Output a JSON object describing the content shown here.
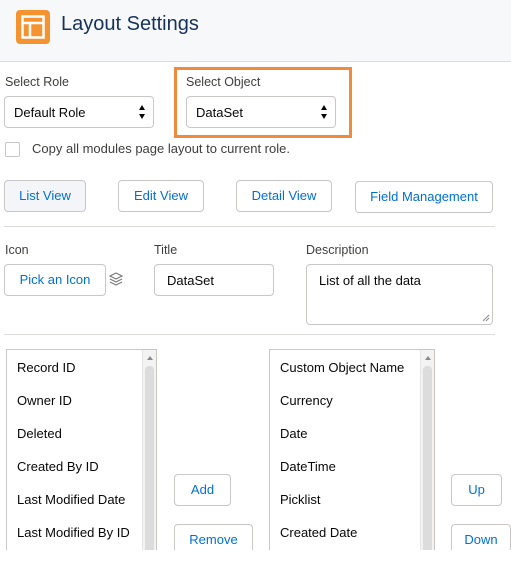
{
  "header": {
    "title": "Layout Settings",
    "icon": "layout-icon",
    "accent": "#f59331"
  },
  "role": {
    "label": "Select Role",
    "value": "Default Role"
  },
  "object": {
    "label": "Select Object",
    "value": "DataSet"
  },
  "copy_option": {
    "label": "Copy all modules page layout to current role.",
    "checked": false
  },
  "view_tabs": [
    {
      "label": "List View",
      "active": true
    },
    {
      "label": "Edit View",
      "active": false
    },
    {
      "label": "Detail View",
      "active": false
    },
    {
      "label": "Field Management",
      "active": false
    }
  ],
  "icon_field": {
    "label": "Icon",
    "button": "Pick an Icon",
    "icon": "layers-icon"
  },
  "title_field": {
    "label": "Title",
    "value": "DataSet"
  },
  "description_field": {
    "label": "Description",
    "value": "List of all the data"
  },
  "available_fields": [
    "Record ID",
    "Owner ID",
    "Deleted",
    "Created By ID",
    "Last Modified Date",
    "Last Modified By ID"
  ],
  "selected_fields": [
    "Custom Object Name",
    "Currency",
    "Date",
    "DateTime",
    "Picklist",
    "Created Date"
  ],
  "actions": {
    "add": "Add",
    "remove": "Remove",
    "up": "Up",
    "down": "Down"
  }
}
